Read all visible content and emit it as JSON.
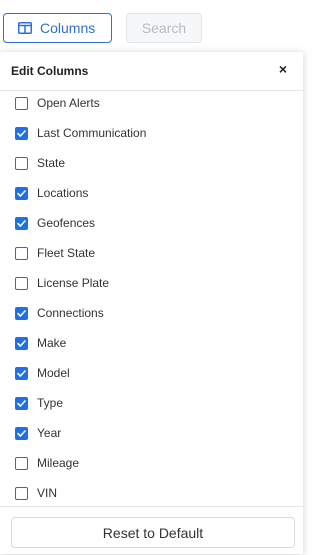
{
  "toolbar": {
    "columns_label": "Columns",
    "search_label": "Search"
  },
  "panel": {
    "title": "Edit Columns",
    "close_glyph": "×",
    "items": [
      {
        "label": "Open Alerts",
        "checked": false
      },
      {
        "label": "Last Communication",
        "checked": true
      },
      {
        "label": "State",
        "checked": false
      },
      {
        "label": "Locations",
        "checked": true
      },
      {
        "label": "Geofences",
        "checked": true
      },
      {
        "label": "Fleet State",
        "checked": false
      },
      {
        "label": "License Plate",
        "checked": false
      },
      {
        "label": "Connections",
        "checked": true
      },
      {
        "label": "Make",
        "checked": true
      },
      {
        "label": "Model",
        "checked": true
      },
      {
        "label": "Type",
        "checked": true
      },
      {
        "label": "Year",
        "checked": true
      },
      {
        "label": "Mileage",
        "checked": false
      },
      {
        "label": "VIN",
        "checked": false
      }
    ],
    "reset_label": "Reset to Default"
  },
  "colors": {
    "accent": "#1f6fe5",
    "button_blue": "#2f6fd6"
  },
  "icons": {
    "columns": "columns-icon",
    "close": "close-icon",
    "check": "checkmark-icon"
  }
}
